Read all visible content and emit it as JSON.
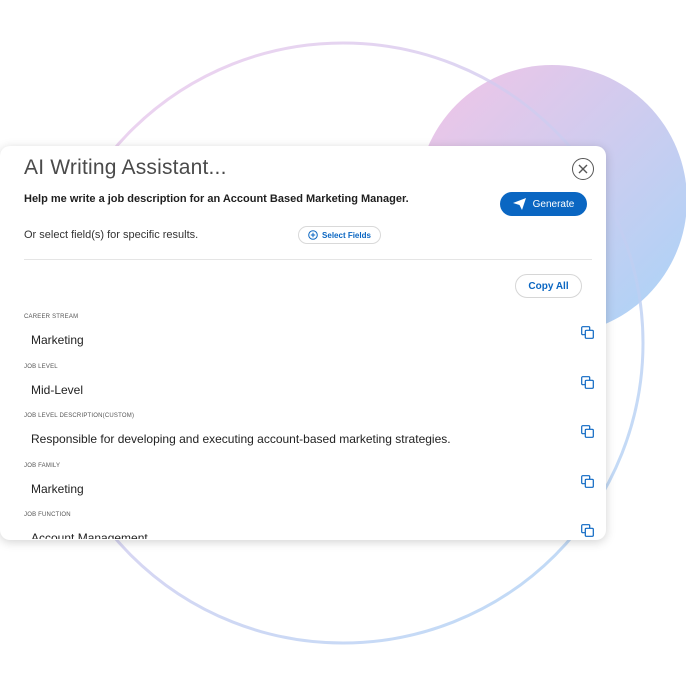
{
  "dialog": {
    "title": "AI Writing Assistant...",
    "prompt": "Help me write a job description for an Account Based Marketing Manager.",
    "generate_label": "Generate",
    "select_hint": "Or select field(s) for specific results.",
    "select_fields_label": "Select Fields",
    "copy_all_label": "Copy All"
  },
  "fields": [
    {
      "label": "CAREER STREAM",
      "value": "Marketing"
    },
    {
      "label": "JOB LEVEL",
      "value": "Mid-Level"
    },
    {
      "label": "JOB LEVEL DESCRIPTION(CUSTOM)",
      "value": "Responsible for developing and executing account-based marketing strategies."
    },
    {
      "label": "JOB FAMILY",
      "value": "Marketing"
    },
    {
      "label": "JOB FUNCTION",
      "value": "Account Management"
    }
  ],
  "icons": {
    "close": "close-icon",
    "generate": "send-icon",
    "select_fields": "plus-circle-icon",
    "copy": "copy-icon"
  },
  "colors": {
    "accent": "#0a66c2",
    "ring": "#d7c7f0",
    "gradient_start": "#f2c4e6",
    "gradient_end": "#a9d2f7"
  }
}
